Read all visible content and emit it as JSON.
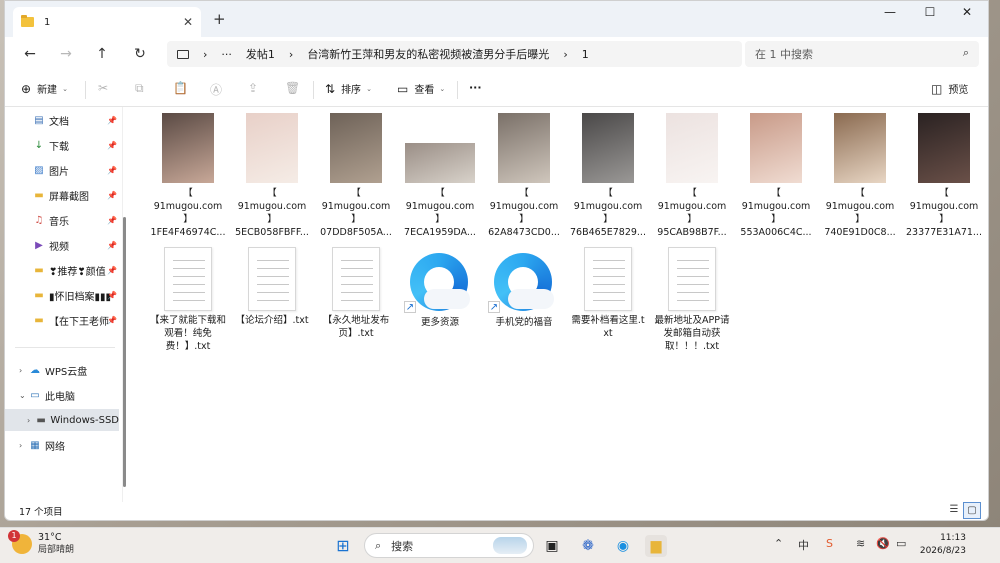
{
  "window": {
    "tab_title": "1",
    "close_tab": "✕",
    "new_tab": "+",
    "minimize": "—",
    "maximize": "☐",
    "close": "✕"
  },
  "address": {
    "more": "···",
    "crumbs": [
      "发帖1",
      "台湾新竹王萍和男友的私密视频被渣男分手后曝光",
      "1"
    ],
    "separator": "›",
    "search_placeholder": "在 1 中搜索"
  },
  "toolbar": {
    "new_label": "新建",
    "sort_label": "排序",
    "view_label": "查看",
    "more_label": "···",
    "preview_label": "预览"
  },
  "sidebar": {
    "quick": [
      {
        "label": "文档",
        "icon": "document-icon"
      },
      {
        "label": "下载",
        "icon": "download-icon"
      },
      {
        "label": "图片",
        "icon": "picture-icon"
      },
      {
        "label": "屏幕截图",
        "icon": "folder-icon"
      },
      {
        "label": "音乐",
        "icon": "music-icon"
      },
      {
        "label": "视频",
        "icon": "video-icon"
      },
      {
        "label": "❣推荐❣颜值",
        "icon": "folder-icon"
      },
      {
        "label": "▮怀旧档案▮▮▮",
        "icon": "folder-icon"
      },
      {
        "label": "【在下王老师",
        "icon": "folder-icon"
      }
    ],
    "tree": [
      {
        "label": "WPS云盘",
        "icon": "cloud-icon"
      },
      {
        "label": "此电脑",
        "icon": "pc-icon"
      },
      {
        "label": "Windows-SSD",
        "icon": "drive-icon"
      },
      {
        "label": "网络",
        "icon": "network-icon"
      }
    ]
  },
  "files": [
    {
      "name": "【\n91mugou.com\n】\n1FE4F46974C...",
      "kind": "image",
      "colors": [
        "#5a4a44",
        "#c8a898"
      ]
    },
    {
      "name": "【\n91mugou.com\n】\n5ECB058FBFF...",
      "kind": "image",
      "colors": [
        "#e8d0c8",
        "#f5ece6"
      ]
    },
    {
      "name": "【\n91mugou.com\n】\n07DD8F505A...",
      "kind": "image",
      "colors": [
        "#6e6258",
        "#b0a090"
      ]
    },
    {
      "name": "【\n91mugou.com\n】\n7ECA1959DA...",
      "kind": "image-wide",
      "colors": [
        "#9a8e86",
        "#d8d2ca"
      ]
    },
    {
      "name": "【\n91mugou.com\n】\n62A8473CD0...",
      "kind": "image",
      "colors": [
        "#7a7068",
        "#cfc6bc"
      ]
    },
    {
      "name": "【\n91mugou.com\n】\n76B465E7829...",
      "kind": "image",
      "colors": [
        "#4a4848",
        "#9a9896"
      ]
    },
    {
      "name": "【\n91mugou.com\n】\n95CAB98B7F...",
      "kind": "image",
      "colors": [
        "#ece2e0",
        "#f8f4f2"
      ]
    },
    {
      "name": "【\n91mugou.com\n】\n553A006C4C...",
      "kind": "image",
      "colors": [
        "#c89a88",
        "#f0dcd2"
      ]
    },
    {
      "name": "【\n91mugou.com\n】\n740E91D0C8...",
      "kind": "image",
      "colors": [
        "#8a6a50",
        "#e8d6c4"
      ]
    },
    {
      "name": "【\n91mugou.com\n】\n23377E31A71...",
      "kind": "image",
      "colors": [
        "#2a2222",
        "#6a5048"
      ]
    },
    {
      "name": "【来了就能下载和观看！纯免费！】.txt",
      "kind": "txt"
    },
    {
      "name": "【论坛介绍】.txt",
      "kind": "txt"
    },
    {
      "name": "【永久地址发布页】.txt",
      "kind": "txt"
    },
    {
      "name": "更多资源",
      "kind": "shortcut"
    },
    {
      "name": "手机党的福音",
      "kind": "shortcut"
    },
    {
      "name": "需要补档看这里.txt",
      "kind": "txt"
    },
    {
      "name": "最新地址及APP请发邮箱自动获取！！！.txt",
      "kind": "txt"
    }
  ],
  "status": {
    "count": "17 个项目"
  },
  "taskbar": {
    "badge": "1",
    "temp": "31°C",
    "weather": "局部晴朗",
    "search": "搜索",
    "time": "11:13",
    "date": "2026/8/23"
  }
}
